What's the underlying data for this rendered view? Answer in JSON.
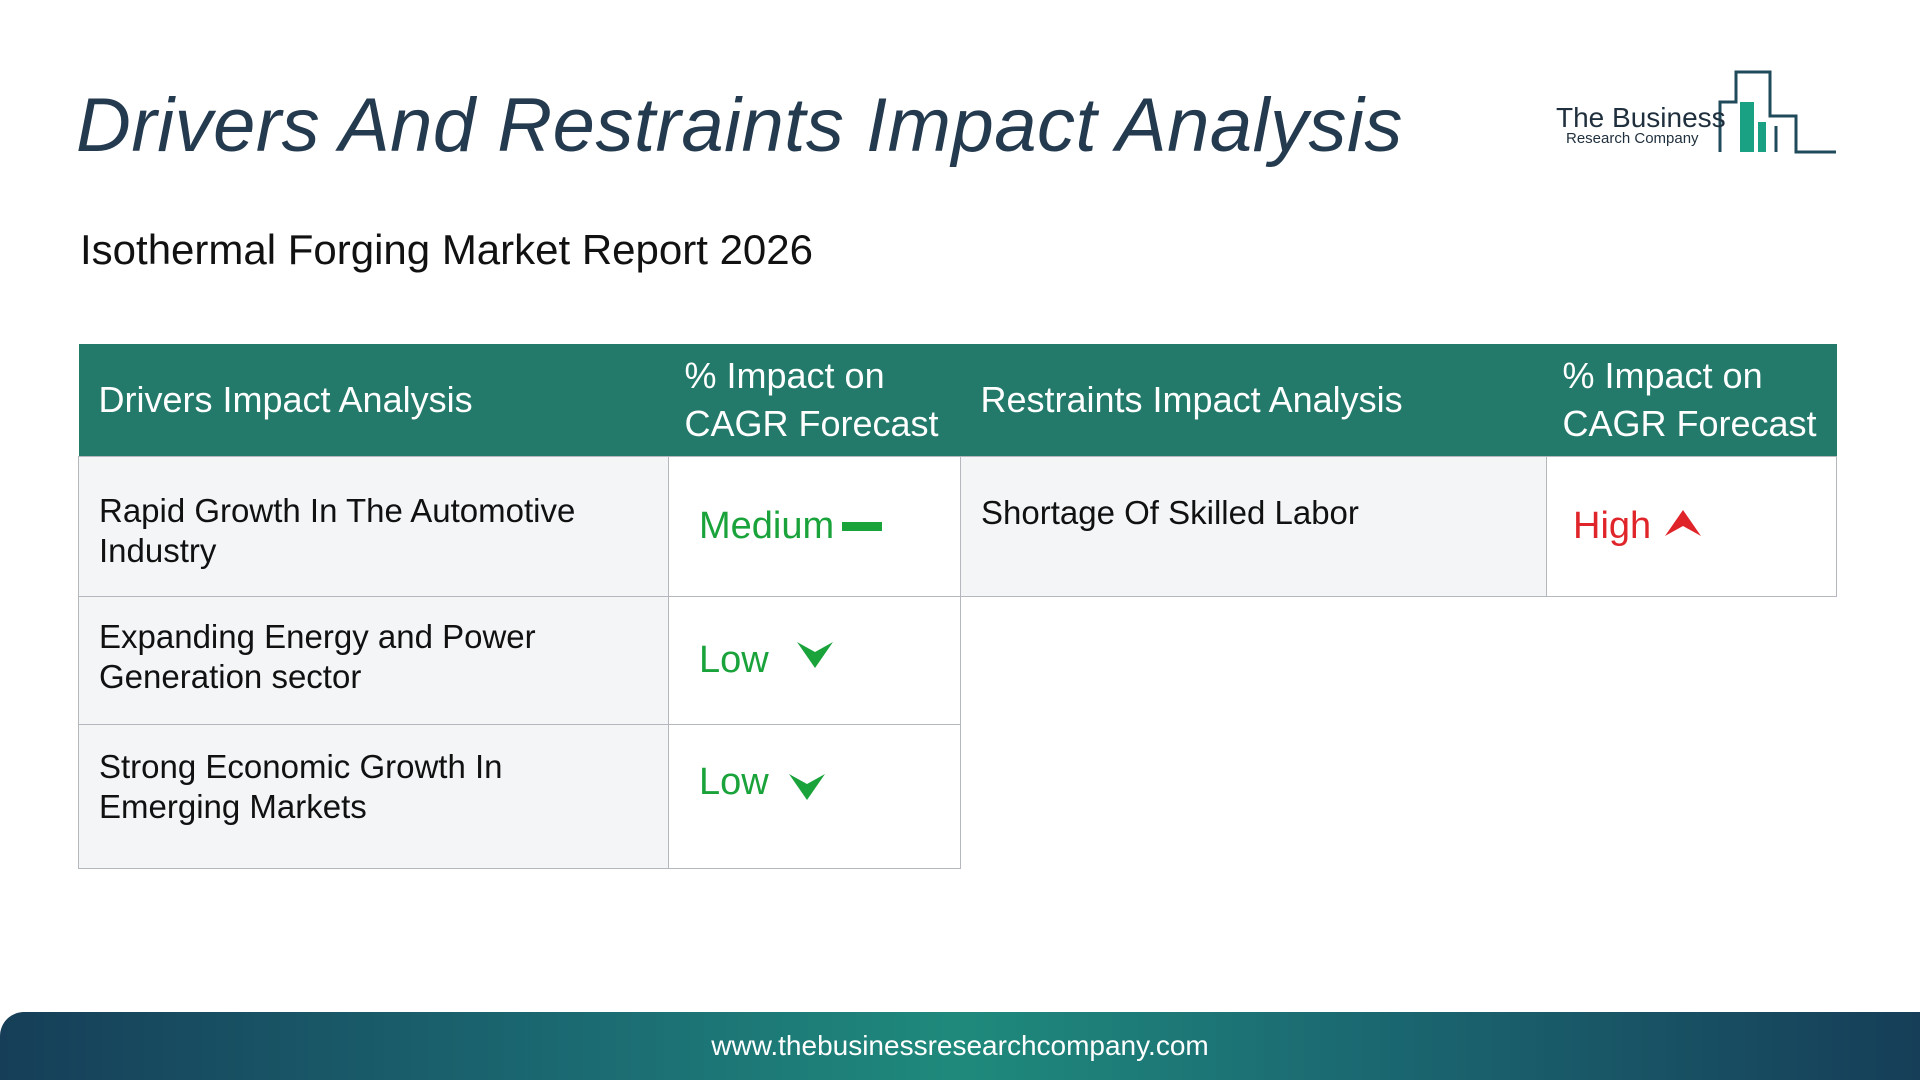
{
  "title": "Drivers And Restraints Impact Analysis",
  "subtitle": "Isothermal Forging Market Report 2026",
  "logo": {
    "name": "The Business",
    "sub": "Research Company",
    "color": "#1aa082"
  },
  "drivers": {
    "header": "Drivers Impact Analysis",
    "impact_header": "% Impact on CAGR Forecast",
    "rows": [
      {
        "factor": "Rapid Growth In The Automotive Industry",
        "impact": "Medium",
        "indicator": "dash-icon"
      },
      {
        "factor": "Expanding Energy and Power Generation sector",
        "impact": "Low",
        "indicator": "arrow-down-icon"
      },
      {
        "factor": "Strong Economic Growth In Emerging Markets",
        "impact": "Low",
        "indicator": "arrow-down-icon"
      }
    ]
  },
  "restraints": {
    "header": "Restraints Impact Analysis",
    "impact_header": "% Impact on CAGR Forecast",
    "rows": [
      {
        "factor": "Shortage Of Skilled Labor",
        "impact": "High",
        "indicator": "arrow-up-icon"
      }
    ]
  },
  "footer": {
    "url": "www.thebusinessresearchcompany.com"
  },
  "colors": {
    "header_bg": "#237a6a",
    "title": "#243a4f",
    "positive": "#1aa33b",
    "negative": "#e0252a"
  }
}
